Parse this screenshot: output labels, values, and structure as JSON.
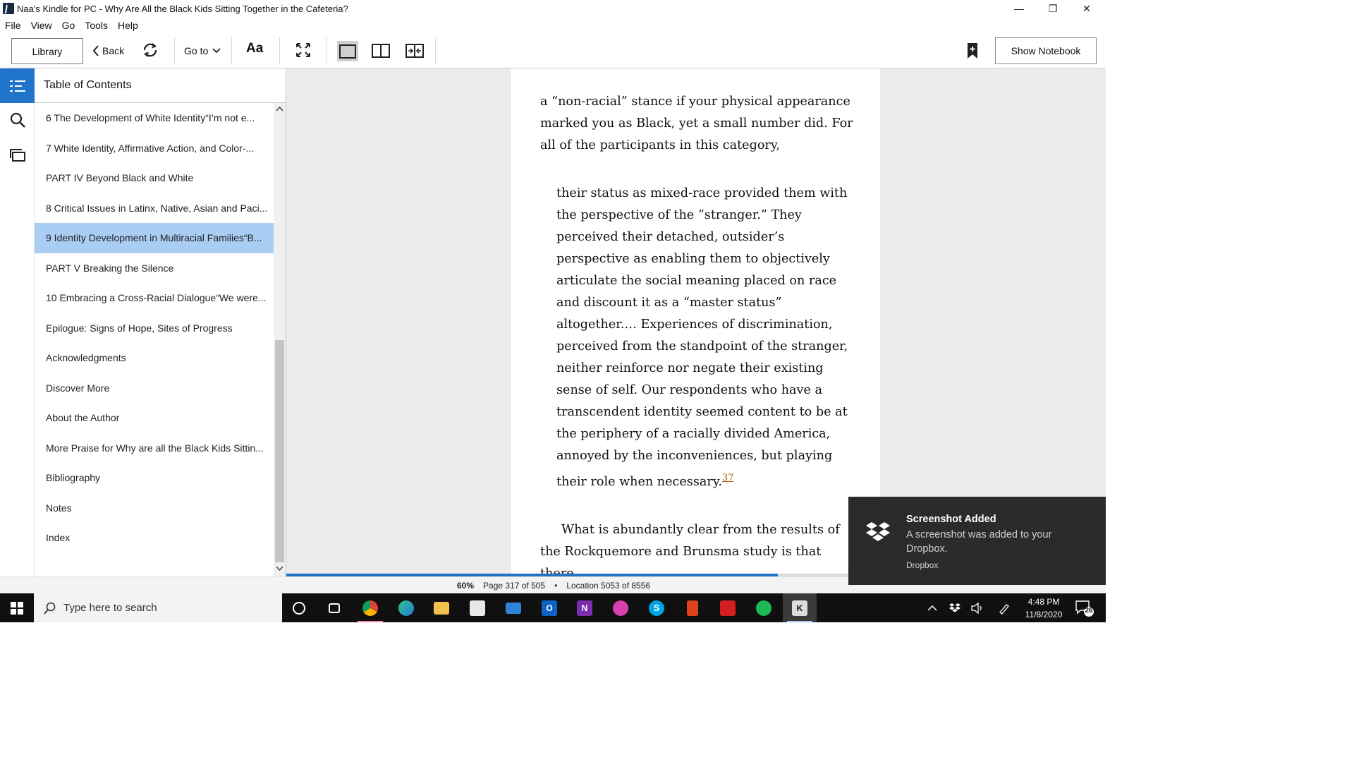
{
  "window": {
    "title": "Naa's Kindle for PC - Why Are All the Black Kids Sitting Together in the Cafeteria?",
    "minimize_glyph": "—",
    "maximize_glyph": "❐",
    "close_glyph": "✕"
  },
  "menu": [
    "File",
    "View",
    "Go",
    "Tools",
    "Help"
  ],
  "toolbar": {
    "library": "Library",
    "back": "Back",
    "goto": "Go to",
    "font": "Aa",
    "show_notebook": "Show Notebook"
  },
  "toc": {
    "title": "Table of Contents",
    "selected_index": 4,
    "items": [
      "6 The Development of White Identity“I’m not e...",
      "7 White Identity, Affirmative Action, and Color-...",
      "PART IV Beyond Black and White",
      "8 Critical Issues in Latinx, Native, Asian and Paci...",
      "9 Identity Development in Multiracial Families“B...",
      "PART V Breaking the Silence",
      "10 Embracing a Cross-Racial Dialogue“We were...",
      "Epilogue: Signs of Hope, Sites of Progress",
      "Acknowledgments",
      "Discover More",
      "About the Author",
      "More Praise for Why are all the Black Kids Sittin...",
      "Bibliography",
      "Notes",
      "Index"
    ]
  },
  "page": {
    "para1": "a “non-racial” stance if your physical appearance marked you as Black, yet a small number did. For all of the participants in this category,",
    "quote": "their status as mixed-race provided them with the perspective of the “stranger.” They perceived their detached, outsider’s perspective as en­abling them to objectively articulate the social meaning placed on race and discount it as a “master status” altogether.… Experiences of dis­crimination, perceived from the standpoint of the stranger, neither reinforce nor negate their existing sense of self. Our respondents who have a transcendent identity seemed content to be at the periphery of a racially divided Amer­ica, annoyed by the inconveniences, but playing their role when necessary.",
    "footnote": "37",
    "para2": "What is abundantly clear from the results of the Rockquemore and Brunsma study is that there"
  },
  "status": {
    "percent": "60%",
    "progress_fraction": 0.6,
    "page": "Page 317 of 505",
    "separator": "•",
    "location": "Location 5053 of 8556"
  },
  "toast": {
    "title": "Screenshot Added",
    "body": "A screenshot was added to your Dropbox.",
    "source": "Dropbox"
  },
  "taskbar": {
    "search_placeholder": "Type here to search",
    "apps": [
      "cortana-icon",
      "task-view-icon",
      "chrome-icon",
      "edge-icon",
      "file-explorer-icon",
      "store-icon",
      "mail-icon",
      "outlook-icon",
      "onenote-icon",
      "whatsapp-icon",
      "skype-icon",
      "office-icon",
      "acrobat-icon",
      "spotify-icon",
      "kindle-icon"
    ],
    "time": "4:48 PM",
    "date": "11/8/2020",
    "notification_count": "26"
  },
  "colors": {
    "accent": "#1f73c9",
    "toc_selected": "#a9cdf3",
    "footnote": "#b15d12",
    "toast_bg": "#2b2b2b",
    "taskbar_bg": "#101010"
  }
}
